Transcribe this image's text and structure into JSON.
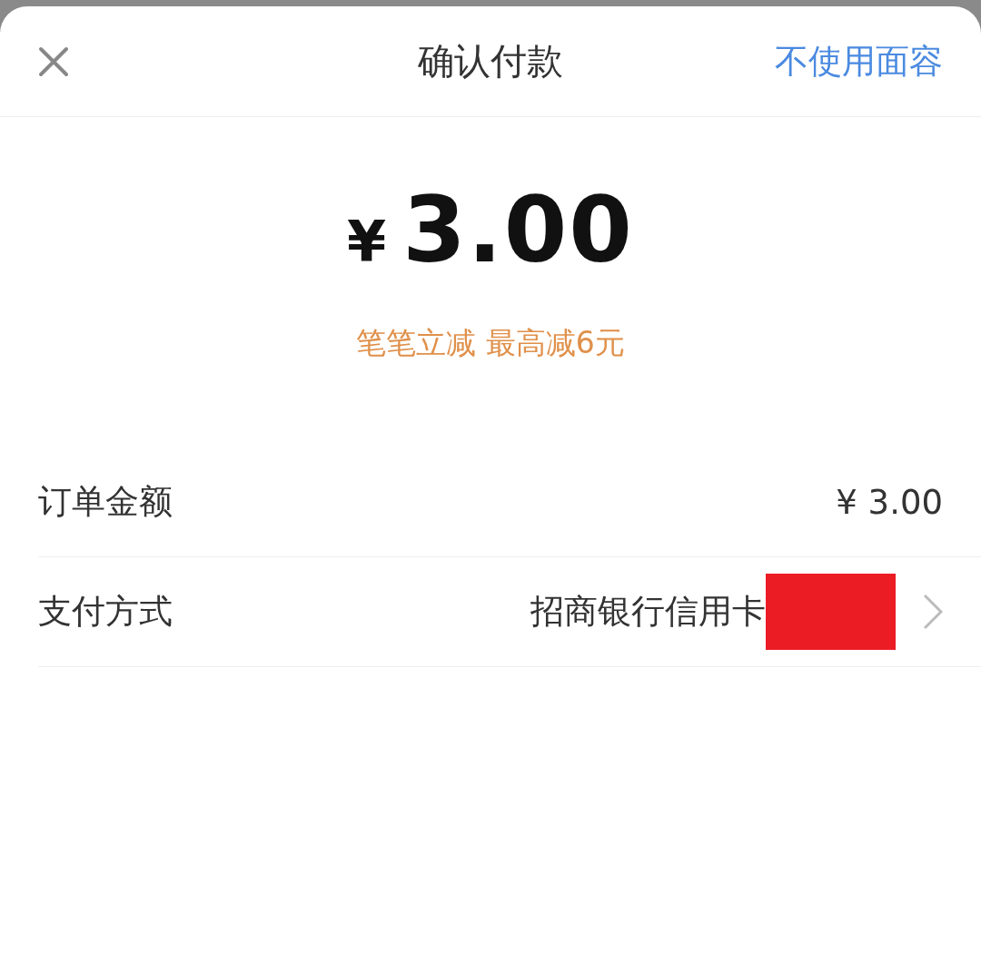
{
  "header": {
    "title": "确认付款",
    "action": "不使用面容"
  },
  "amount": {
    "currency": "¥",
    "value": "3.00"
  },
  "promo": "笔笔立减 最高减6元",
  "rows": [
    {
      "label": "订单金额",
      "value": "¥ 3.00",
      "kind": "text"
    },
    {
      "label": "支付方式",
      "value": "招商银行信用卡",
      "kind": "link"
    }
  ]
}
